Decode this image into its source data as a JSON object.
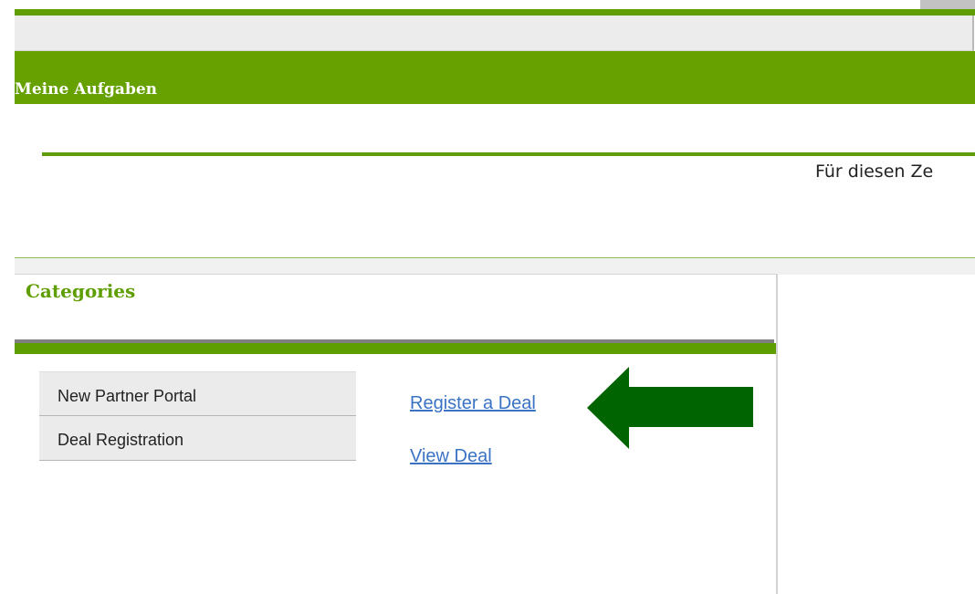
{
  "header": {
    "title": "Meine Aufgaben"
  },
  "info": {
    "text": "Für diesen Ze"
  },
  "categories": {
    "title": "Categories",
    "items": [
      {
        "label": "New Partner Portal"
      },
      {
        "label": "Deal Registration"
      }
    ],
    "links": [
      {
        "label": "Register a Deal "
      },
      {
        "label": "View Deal"
      }
    ]
  },
  "colors": {
    "brand_green": "#66a100",
    "arrow_green": "#006400",
    "link_blue": "#3a73c4"
  },
  "icons": {
    "arrow": "left-arrow-icon"
  }
}
